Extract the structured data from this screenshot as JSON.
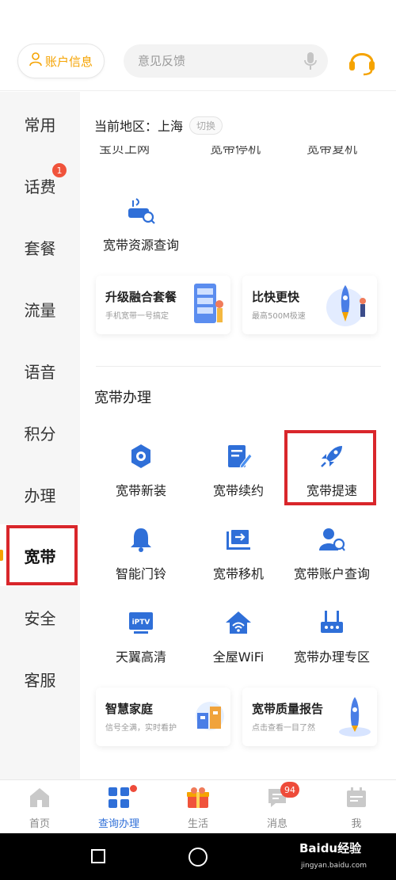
{
  "header": {
    "account_label": "账户信息",
    "search_placeholder": "意见反馈"
  },
  "sidebar": {
    "items": [
      {
        "label": "常用"
      },
      {
        "label": "话费",
        "badge": "1"
      },
      {
        "label": "套餐"
      },
      {
        "label": "流量"
      },
      {
        "label": "语音"
      },
      {
        "label": "积分"
      },
      {
        "label": "办理"
      },
      {
        "label": "宽带",
        "active": true
      },
      {
        "label": "安全"
      },
      {
        "label": "客服"
      }
    ]
  },
  "content": {
    "region_label": "当前地区：上海",
    "region_switch": "切换",
    "cut_items": [
      "宝贝上网",
      "宽带停机",
      "宽带复机"
    ],
    "query_item": "宽带资源查询",
    "promos_top": [
      {
        "title": "升级融合套餐",
        "subtitle": "手机宽带一号搞定"
      },
      {
        "title": "比快更快",
        "subtitle": "最高500M极速"
      }
    ],
    "section_title": "宽带办理",
    "services": [
      {
        "label": "宽带新装",
        "icon": "gear-icon"
      },
      {
        "label": "宽带续约",
        "icon": "edit-icon"
      },
      {
        "label": "宽带提速",
        "icon": "rocket-icon"
      },
      {
        "label": "智能门铃",
        "icon": "bell-icon"
      },
      {
        "label": "宽带移机",
        "icon": "move-icon"
      },
      {
        "label": "宽带账户查询",
        "icon": "user-search-icon"
      },
      {
        "label": "天翼高清",
        "icon": "iptv-icon"
      },
      {
        "label": "全屋WiFi",
        "icon": "home-wifi-icon"
      },
      {
        "label": "宽带办理专区",
        "icon": "router-icon"
      }
    ],
    "promos_bottom": [
      {
        "title": "智慧家庭",
        "subtitle": "信号全满，实时看护"
      },
      {
        "title": "宽带质量报告",
        "subtitle": "点击查看一目了然"
      }
    ],
    "iptv_text": "iPTV"
  },
  "bottom_nav": {
    "tabs": [
      {
        "label": "首页"
      },
      {
        "label": "查询办理",
        "active": true
      },
      {
        "label": "生活"
      },
      {
        "label": "消息",
        "badge": "94"
      },
      {
        "label": "我"
      }
    ]
  },
  "watermark": {
    "brand": "Baidu经验",
    "url": "jingyan.baidu.com"
  },
  "colors": {
    "accent": "#f5a300",
    "icon_blue": "#2f6fd8",
    "highlight_red": "#d9262b",
    "badge_red": "#ee4b3a"
  }
}
